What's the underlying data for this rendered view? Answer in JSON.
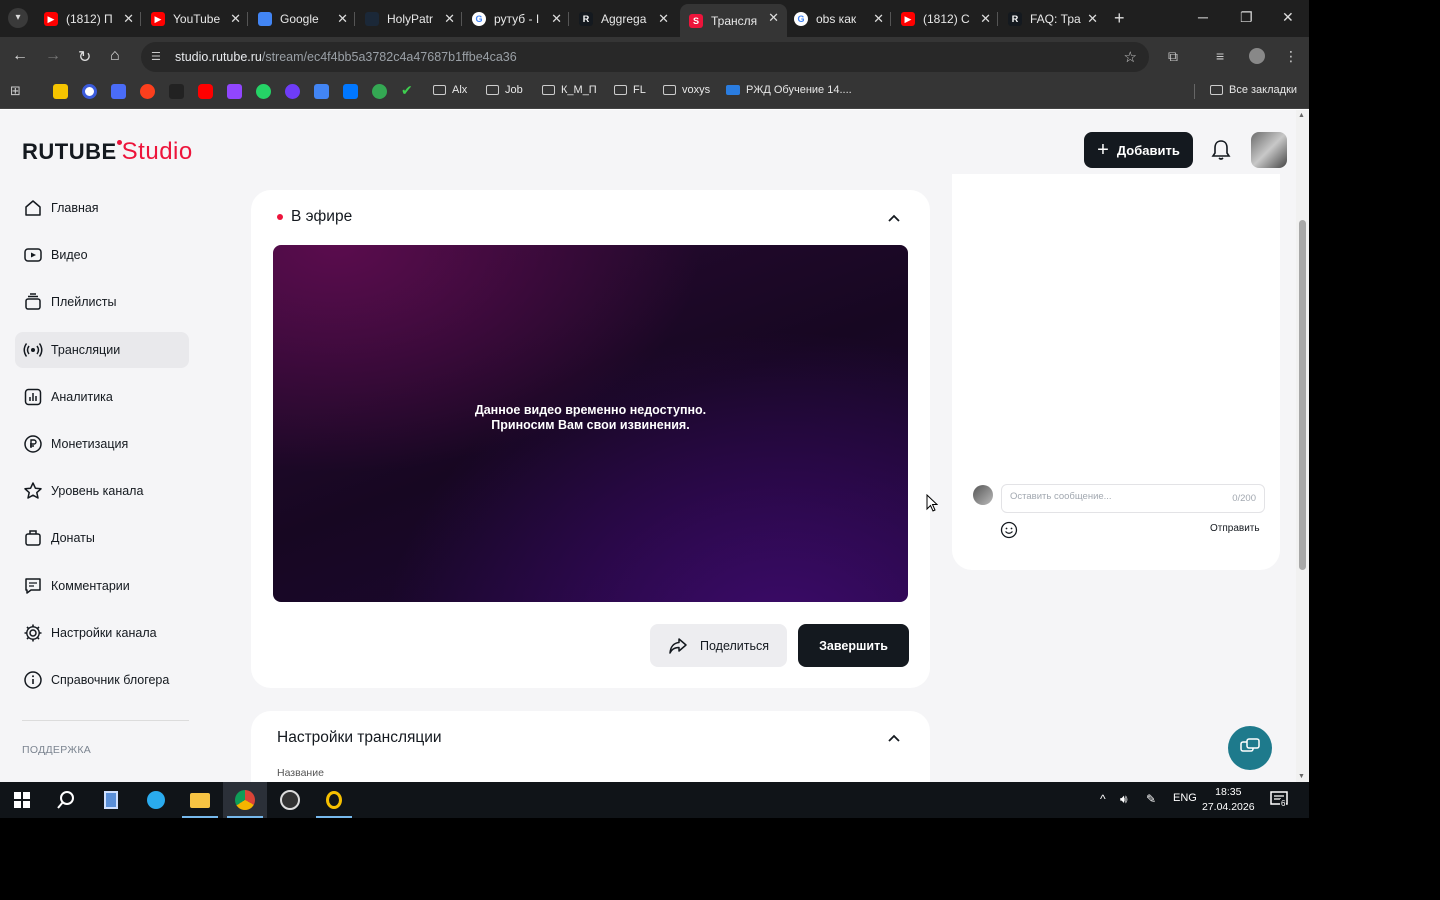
{
  "browser": {
    "tabs": [
      {
        "title": "(1812) П",
        "favicon": "youtube",
        "color": "#ff0000"
      },
      {
        "title": "YouTube",
        "favicon": "youtube",
        "color": "#ff0000"
      },
      {
        "title": "Google",
        "favicon": "google-translate",
        "color": "#4285f4"
      },
      {
        "title": "HolyPatr",
        "favicon": "steam",
        "color": "#1b2838"
      },
      {
        "title": "рутуб - I",
        "favicon": "google",
        "color": "#ffffff"
      },
      {
        "title": "Aggrega",
        "favicon": "rutube",
        "color": "#14191f"
      },
      {
        "title": "Трансля",
        "favicon": "rutube-studio",
        "color": "#ed143b",
        "active": true
      },
      {
        "title": "obs как",
        "favicon": "google",
        "color": "#ffffff"
      },
      {
        "title": "(1812) С",
        "favicon": "youtube",
        "color": "#ff0000"
      },
      {
        "title": "FAQ: Тра",
        "favicon": "rutube",
        "color": "#14191f"
      }
    ],
    "url_host": "studio.rutube.ru",
    "url_path": "/stream/ec4f4bb5a3782c4a47687b1ffbe4ca36",
    "bookmarks": {
      "folders": [
        "Alx",
        "Job",
        "К_М_П",
        "FL",
        "voxys"
      ],
      "rzd": "РЖД Обучение 14....",
      "all": "Все закладки"
    }
  },
  "header": {
    "logo_main": "RUTUBE",
    "logo_studio": "Studio",
    "add_button": "Добавить",
    "brand_color": "#ed143b"
  },
  "sidebar": {
    "items": [
      {
        "label": "Главная",
        "icon": "home-icon"
      },
      {
        "label": "Видео",
        "icon": "video-icon"
      },
      {
        "label": "Плейлисты",
        "icon": "playlist-icon"
      },
      {
        "label": "Трансляции",
        "icon": "broadcast-icon",
        "active": true
      },
      {
        "label": "Аналитика",
        "icon": "analytics-icon"
      },
      {
        "label": "Монетизация",
        "icon": "ruble-icon"
      },
      {
        "label": "Уровень канала",
        "icon": "star-icon"
      },
      {
        "label": "Донаты",
        "icon": "donate-icon"
      },
      {
        "label": "Комментарии",
        "icon": "comment-icon"
      },
      {
        "label": "Настройки канала",
        "icon": "gear-icon"
      },
      {
        "label": "Справочник блогера",
        "icon": "info-icon"
      }
    ],
    "support_heading": "ПОДДЕРЖКА"
  },
  "live": {
    "title": "В эфире",
    "unavailable_line1": "Данное видео временно недоступно.",
    "unavailable_line2": "Приносим Вам свои извинения.",
    "share_button": "Поделиться",
    "end_button": "Завершить"
  },
  "settings": {
    "title": "Настройки трансляции",
    "name_label": "Название"
  },
  "chat": {
    "placeholder": "Оставить сообщение...",
    "counter": "0/200",
    "send_button": "Отправить"
  },
  "taskbar": {
    "language": "ENG",
    "time": "18:35",
    "date": "27.04.2026",
    "notifications": "6"
  }
}
